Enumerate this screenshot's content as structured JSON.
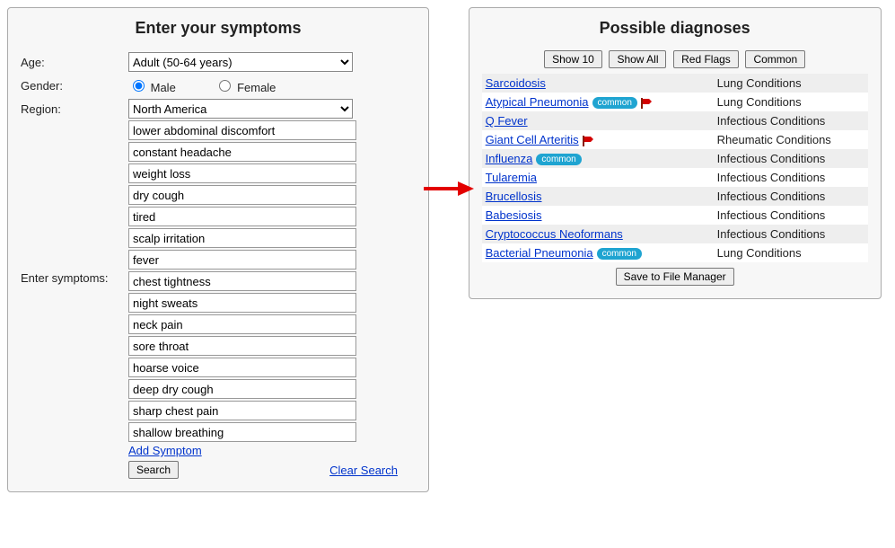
{
  "left": {
    "title": "Enter your symptoms",
    "age_label": "Age:",
    "age_value": "Adult (50-64 years)",
    "gender_label": "Gender:",
    "gender_male": "Male",
    "gender_female": "Female",
    "gender_selected": "male",
    "region_label": "Region:",
    "region_value": "North America",
    "symptoms_label": "Enter symptoms:",
    "symptoms": [
      "lower abdominal discomfort",
      "constant headache",
      "weight loss",
      "dry cough",
      "tired",
      "scalp irritation",
      "fever",
      "chest tightness",
      "night sweats",
      "neck pain",
      "sore throat",
      "hoarse voice",
      "deep dry cough",
      "sharp chest pain",
      "shallow breathing"
    ],
    "add_symptom": "Add Symptom",
    "search_button": "Search",
    "clear_search": "Clear Search"
  },
  "right": {
    "title": "Possible diagnoses",
    "filters": {
      "show10": "Show 10",
      "showall": "Show All",
      "redflags": "Red Flags",
      "common": "Common"
    },
    "results": [
      {
        "name": "Sarcoidosis",
        "category": "Lung Conditions",
        "common": false,
        "flag": false
      },
      {
        "name": "Atypical Pneumonia",
        "category": "Lung Conditions",
        "common": true,
        "flag": true
      },
      {
        "name": "Q Fever",
        "category": "Infectious Conditions",
        "common": false,
        "flag": false
      },
      {
        "name": "Giant Cell Arteritis",
        "category": "Rheumatic Conditions",
        "common": false,
        "flag": true
      },
      {
        "name": "Influenza",
        "category": "Infectious Conditions",
        "common": true,
        "flag": false
      },
      {
        "name": "Tularemia",
        "category": "Infectious Conditions",
        "common": false,
        "flag": false
      },
      {
        "name": "Brucellosis",
        "category": "Infectious Conditions",
        "common": false,
        "flag": false
      },
      {
        "name": "Babesiosis",
        "category": "Infectious Conditions",
        "common": false,
        "flag": false
      },
      {
        "name": "Cryptococcus Neoformans",
        "category": "Infectious Conditions",
        "common": false,
        "flag": false
      },
      {
        "name": "Bacterial Pneumonia",
        "category": "Lung Conditions",
        "common": true,
        "flag": false
      }
    ],
    "common_badge": "common",
    "save_button": "Save to File Manager"
  }
}
